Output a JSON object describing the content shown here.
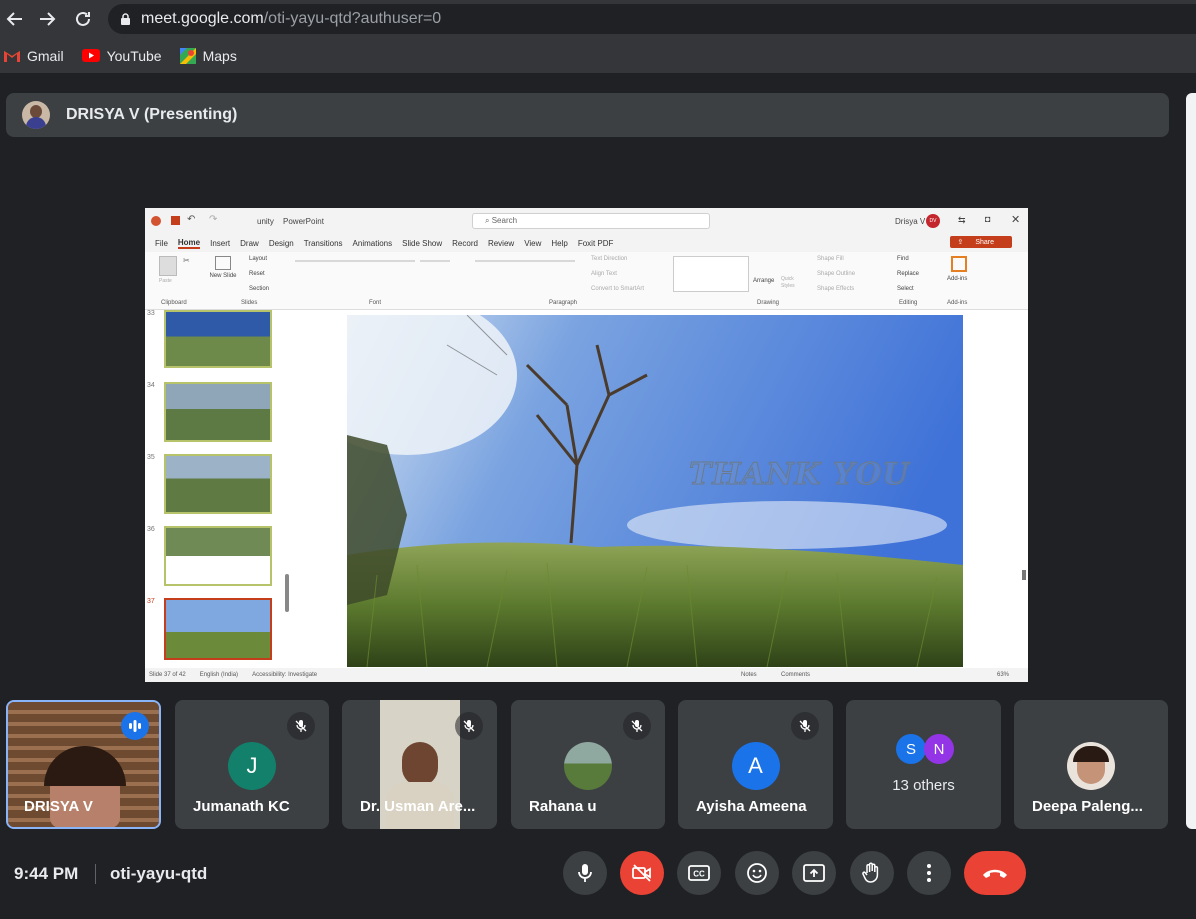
{
  "browser": {
    "url_host": "meet.google.com",
    "url_path": "/oti-yayu-qtd?authuser=0",
    "bookmarks": [
      {
        "label": "Gmail",
        "icon": "gmail-icon"
      },
      {
        "label": "YouTube",
        "icon": "youtube-icon"
      },
      {
        "label": "Maps",
        "icon": "maps-icon"
      }
    ]
  },
  "presenter": {
    "label": "DRISYA V (Presenting)"
  },
  "ppt": {
    "file_name": "unity",
    "app_name": "PowerPoint",
    "search_placeholder": "Search",
    "user": "Drisya V",
    "user_initials": "DV",
    "share_label": "Share",
    "tabs": [
      "File",
      "Home",
      "Insert",
      "Draw",
      "Design",
      "Transitions",
      "Animations",
      "Slide Show",
      "Record",
      "Review",
      "View",
      "Help",
      "Foxit PDF"
    ],
    "active_tab": "Home",
    "ribbon_groups": [
      "Clipboard",
      "Slides",
      "Font",
      "Paragraph",
      "Drawing",
      "Editing",
      "Add-ins"
    ],
    "ribbon_items": {
      "paste": "Paste",
      "new_slide": "New Slide",
      "layout": "Layout",
      "reset": "Reset",
      "section": "Section",
      "text_direction": "Text Direction",
      "align_text": "Align Text",
      "smartart": "Convert to SmartArt",
      "arrange": "Arrange",
      "quick_styles": "Quick Styles",
      "shape_fill": "Shape Fill",
      "shape_outline": "Shape Outline",
      "shape_effects": "Shape Effects",
      "find": "Find",
      "replace": "Replace",
      "select": "Select",
      "add_ins": "Add-ins"
    },
    "thumb_numbers": [
      "33",
      "34",
      "35",
      "36",
      "37"
    ],
    "slide_text": "THANK YOU",
    "status": {
      "slide_count": "Slide 37 of 42",
      "language": "English (India)",
      "accessibility": "Accessibility: Investigate",
      "notes": "Notes",
      "comments": "Comments",
      "zoom": "63%"
    }
  },
  "participants": [
    {
      "name": "DRISYA V",
      "speaking": true,
      "type": "video"
    },
    {
      "name": "Jumanath KC",
      "initial": "J",
      "avatar_color": "#12806a",
      "muted": true
    },
    {
      "name": "Dr. Usman Are...",
      "muted": true,
      "type": "video"
    },
    {
      "name": "Rahana u",
      "muted": true,
      "type": "photo"
    },
    {
      "name": "Ayisha Ameena",
      "initial": "A",
      "avatar_color": "#1a73e8",
      "muted": true
    },
    {
      "name": "13 others",
      "initials": [
        "S",
        "N"
      ],
      "colors": [
        "#1a73e8",
        "#9334e6"
      ]
    },
    {
      "name": "Deepa Paleng...",
      "type": "photo"
    }
  ],
  "footer": {
    "time": "9:44 PM",
    "meeting_code": "oti-yayu-qtd"
  },
  "controls": [
    "mic-icon",
    "camera-off-icon",
    "captions-icon",
    "emoji-icon",
    "present-icon",
    "raise-hand-icon",
    "more-options-icon",
    "end-call-icon"
  ],
  "colors": {
    "end_call": "#ea4335",
    "camera_off": "#ea4335",
    "speaking_border": "#8ab4f8"
  }
}
